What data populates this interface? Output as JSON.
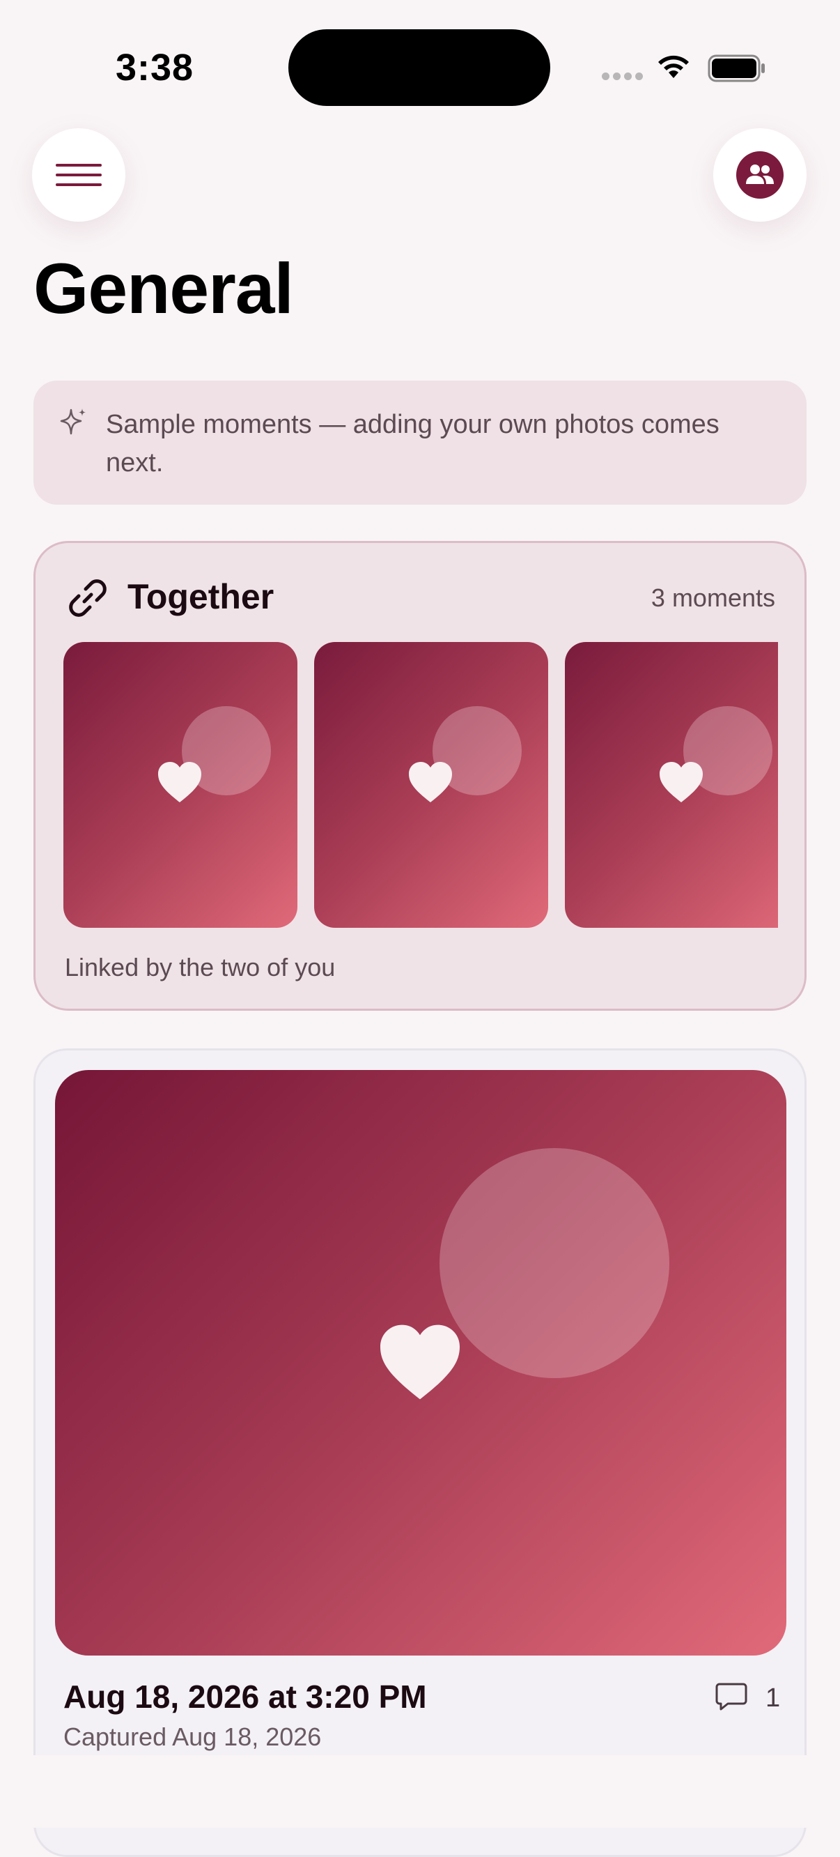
{
  "status_bar": {
    "time": "3:38"
  },
  "header": {
    "menu_icon": "hamburger-icon",
    "partner_icon": "couple-icon",
    "title": "General"
  },
  "banner": {
    "icon": "sparkle-icon",
    "text": "Sample moments — adding your own photos comes next."
  },
  "together": {
    "icon": "link-icon",
    "title": "Together",
    "count": "3 moments",
    "caption": "Linked by the two of you",
    "thumbnails": [
      "heart-icon",
      "heart-icon",
      "heart-icon"
    ]
  },
  "moment": {
    "date": "Aug 18, 2026 at 3:20 PM",
    "comment_count": "1",
    "captured": "Captured Aug 18, 2026"
  },
  "colors": {
    "brand": "#7b1a3c",
    "background": "#f9f5f6",
    "gradient_start": "#761637",
    "gradient_end": "#e16a79"
  }
}
